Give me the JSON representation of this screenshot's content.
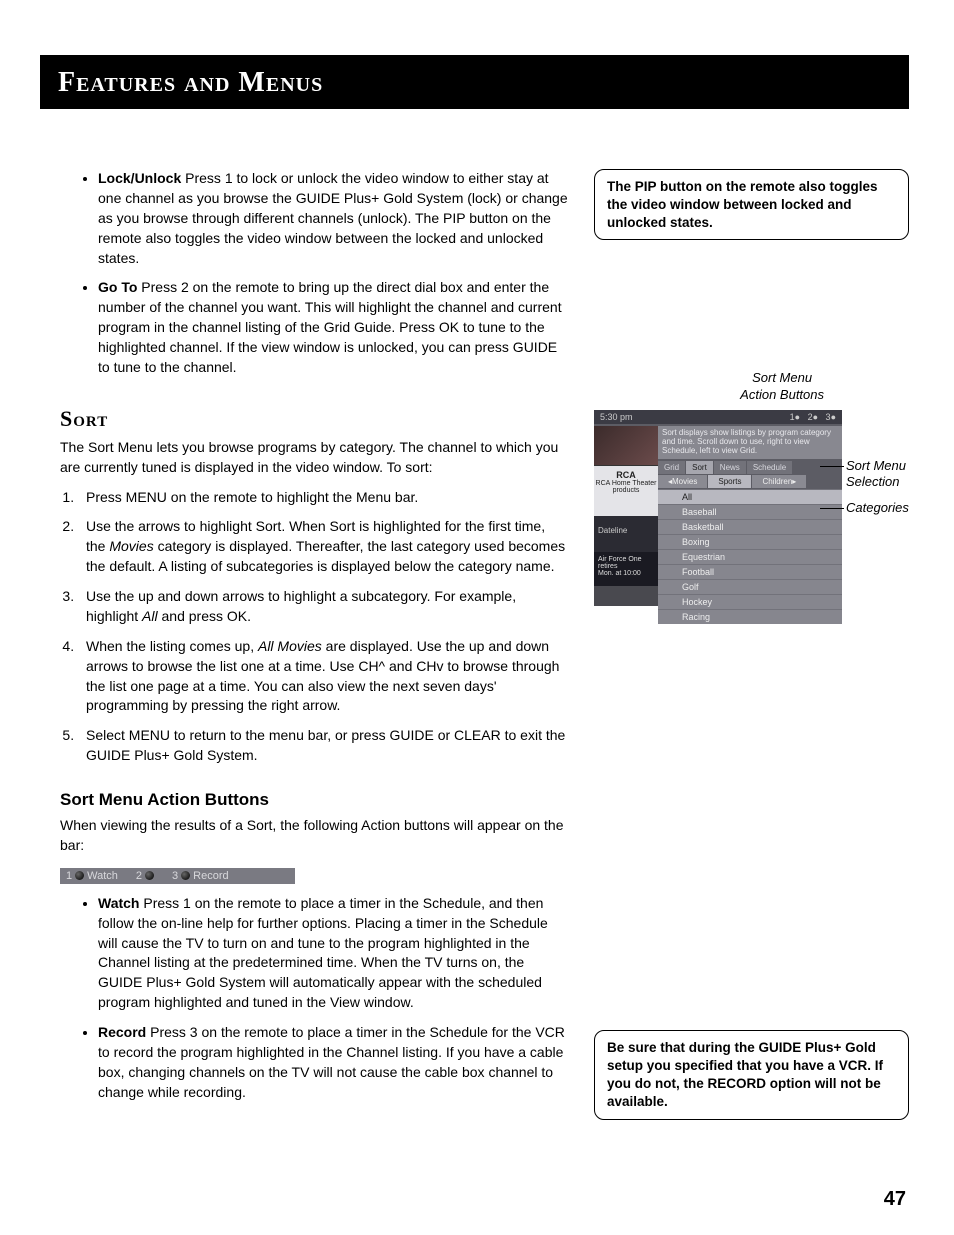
{
  "header": {
    "title": "Features and Menus"
  },
  "topBullets": [
    {
      "term": "Lock/Unlock",
      "text": "  Press 1 to lock or unlock the video window to either stay at one channel as you browse the GUIDE Plus+ Gold System (lock) or change as you browse through different channels (unlock). The PIP button on the remote also toggles the video window between the locked and unlocked states."
    },
    {
      "term": "Go To",
      "text": "   Press 2 on the remote to bring up the direct dial box and enter the number of the channel you want. This will highlight the channel and current program in the channel listing of the Grid Guide. Press OK to tune to the highlighted channel. If the view window is unlocked, you can press GUIDE to tune to the channel."
    }
  ],
  "sort": {
    "heading": "Sort",
    "lead": "The Sort Menu lets you browse programs by category. The channel to which you are currently tuned is displayed in the video window. To sort:",
    "steps": [
      "Press MENU on the remote to highlight the Menu bar.",
      "Use the arrows to highlight Sort. When Sort is highlighted for the first time, the <em>Movies</em> category is displayed. Thereafter, the last category used becomes the default. A listing of subcategories is displayed below the category name.",
      "Use the up and down arrows to highlight a subcategory. For example, highlight <em>All</em> and press OK.",
      "When the listing comes up, <em>All Movies</em> are displayed.  Use the up and down arrows to browse the list one at a time. Use CH^ and CHv to browse through the list one page at a time. You can also view the next seven days' programming by pressing the right arrow.",
      "Select MENU to return to the menu bar, or press GUIDE or CLEAR to exit the GUIDE Plus+ Gold System."
    ]
  },
  "actionButtons": {
    "heading": "Sort Menu Action Buttons",
    "lead": "When viewing the results of a Sort, the following Action buttons will appear on the bar:",
    "strip": {
      "a1": "1",
      "a1l": "Watch",
      "a2": "2",
      "a3": "3",
      "a3l": "Record"
    },
    "bullets": [
      {
        "term": "Watch",
        "text": "   Press 1 on the remote to place a timer in the Schedule, and then follow the on-line help for further options. Placing a timer in the Schedule will cause the TV to turn on and tune to the program highlighted in the Channel listing at the predetermined time. When the TV turns on, the GUIDE Plus+ Gold System will automatically appear with the scheduled program highlighted and tuned in the View window."
      },
      {
        "term": "Record",
        "text": "   Press 3 on the remote to place a timer in the Schedule for the VCR to record the program highlighted in the Channel listing. If you have a cable box, changing channels on the TV will not cause the cable box channel to change while recording."
      }
    ]
  },
  "sidebar": {
    "callout1": "The PIP button on the remote also toggles the video window between locked and unlocked states.",
    "callout2": "Be sure that during the GUIDE Plus+ Gold setup you specified that you have a VCR. If you do not, the RECORD option will not be available.",
    "labels": {
      "top": "Sort Menu\nAction Buttons",
      "sel": "Sort Menu\nSelection",
      "cats": "Categories"
    },
    "mock": {
      "time": "5:30 pm",
      "hint": "Sort displays show listings by program category and time. Scroll down to use, right to view Schedule, left to view Grid.",
      "tabs": [
        "Grid",
        "Sort",
        "News",
        "Schedule"
      ],
      "subtabs": [
        "◂Movies",
        "Sports",
        "Children▸"
      ],
      "cats": [
        "All",
        "Baseball",
        "Basketball",
        "Boxing",
        "Equestrian",
        "Football",
        "Golf",
        "Hockey",
        "Racing"
      ],
      "rca": "RCA Home Theater products",
      "dateline": "Dateline",
      "af1": "Air Force One retires",
      "af2": "Mon. at 10:00"
    }
  },
  "pageNumber": "47"
}
